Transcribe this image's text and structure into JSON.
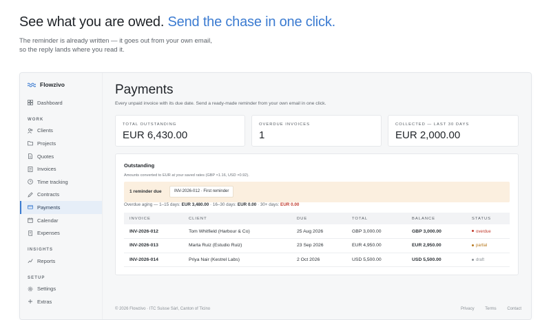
{
  "hero": {
    "title_plain": "See what you are owed.",
    "title_accent": "Send the chase in one click.",
    "subtitle": "The reminder is already written — it goes out from your own email, so the reply lands where you read it."
  },
  "brand": {
    "name": "Flowzivo",
    "icon": "wave-logo-icon"
  },
  "sidebar": {
    "top": [
      {
        "label": "Dashboard",
        "icon": "grid-icon"
      }
    ],
    "sections": [
      {
        "title": "WORK",
        "items": [
          {
            "label": "Clients",
            "icon": "users-icon"
          },
          {
            "label": "Projects",
            "icon": "folder-icon"
          },
          {
            "label": "Quotes",
            "icon": "document-icon"
          },
          {
            "label": "Invoices",
            "icon": "invoice-icon"
          },
          {
            "label": "Time tracking",
            "icon": "clock-icon"
          },
          {
            "label": "Contracts",
            "icon": "pen-icon"
          },
          {
            "label": "Payments",
            "icon": "card-icon",
            "active": true
          },
          {
            "label": "Calendar",
            "icon": "calendar-icon"
          },
          {
            "label": "Expenses",
            "icon": "receipt-icon"
          }
        ]
      },
      {
        "title": "INSIGHTS",
        "items": [
          {
            "label": "Reports",
            "icon": "chart-icon"
          }
        ]
      },
      {
        "title": "SETUP",
        "items": [
          {
            "label": "Settings",
            "icon": "gear-icon"
          },
          {
            "label": "Extras",
            "icon": "plus-icon"
          }
        ]
      }
    ]
  },
  "page": {
    "title": "Payments",
    "subtitle": "Every unpaid invoice with its due date. Send a ready-made reminder from your own email in one click."
  },
  "stats": [
    {
      "label": "TOTAL OUTSTANDING",
      "value": "EUR 6,430.00"
    },
    {
      "label": "OVERDUE INVOICES",
      "value": "1"
    },
    {
      "label": "COLLECTED — LAST 30 DAYS",
      "value": "EUR 2,000.00"
    }
  ],
  "outstanding": {
    "title": "Outstanding",
    "note": "Amounts converted to EUR at your saved rates (GBP ×1.16, USD ×0.92).",
    "banner_label": "1 reminder due",
    "banner_chip": "INV-2026-012 · First reminder",
    "aging": {
      "prefix": "Overdue aging — 1–15 days:",
      "a1": "EUR 3,480.00",
      "mid1": "· 16–30 days:",
      "a2": "EUR 0.00",
      "mid2": "· 30+ days:",
      "a3": "EUR 0.00"
    },
    "columns": [
      "INVOICE",
      "CLIENT",
      "DUE",
      "TOTAL",
      "BALANCE",
      "STATUS"
    ],
    "rows": [
      {
        "invoice": "INV-2026-012",
        "client": "Tom Whitfield (Harbour & Co)",
        "due": "25 Aug 2026",
        "total": "GBP 3,000.00",
        "balance": "GBP 3,000.00",
        "status": "overdue",
        "status_color": "#c0392b"
      },
      {
        "invoice": "INV-2026-013",
        "client": "Marta Ruiz (Estudio Ruiz)",
        "due": "23 Sep 2026",
        "total": "EUR 4,950.00",
        "balance": "EUR 2,950.00",
        "status": "partial",
        "status_color": "#b7791f"
      },
      {
        "invoice": "INV-2026-014",
        "client": "Priya Nair (Kestrel Labs)",
        "due": "2 Oct 2026",
        "total": "USD 5,500.00",
        "balance": "USD 5,500.00",
        "status": "draft",
        "status_color": "#8a9096"
      }
    ]
  },
  "footer": {
    "copyright": "© 2026 Flowzivo · ITC Suisse Sàrl, Canton of Ticino",
    "links": [
      "Privacy",
      "Terms",
      "Contact"
    ]
  }
}
